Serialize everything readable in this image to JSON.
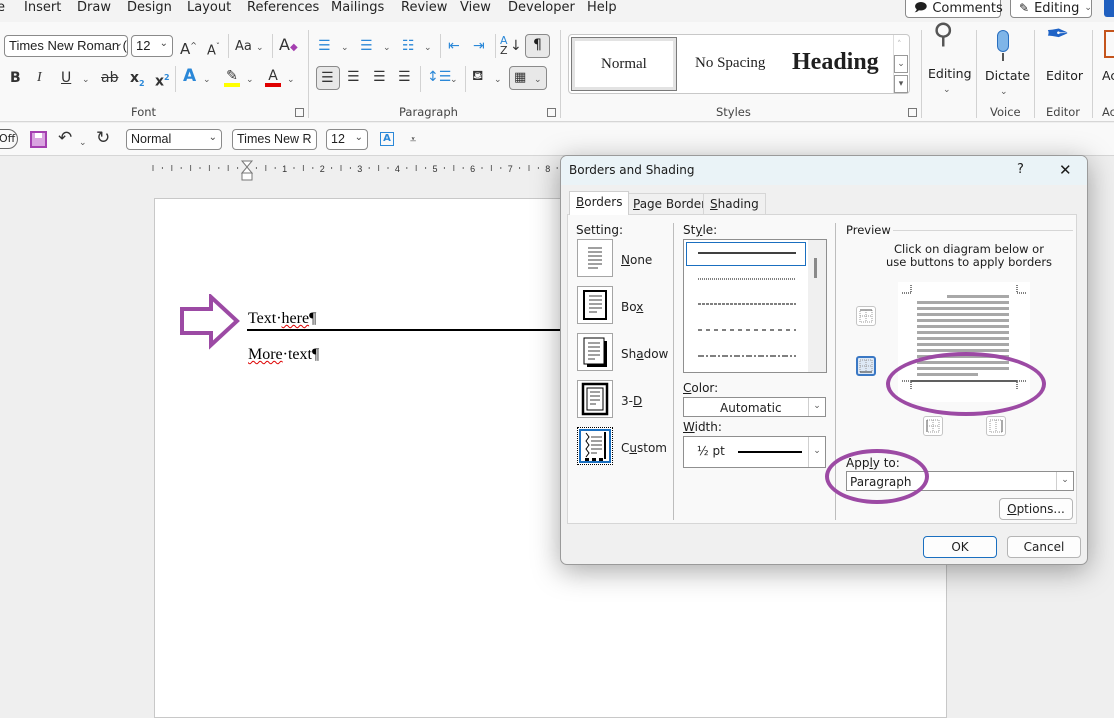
{
  "menubar": {
    "tabs": [
      "e",
      "Insert",
      "Draw",
      "Design",
      "Layout",
      "References",
      "Mailings",
      "Review",
      "View",
      "Developer",
      "Help"
    ],
    "comments_label": "Comments",
    "editing_mode_label": "Editing"
  },
  "ribbon": {
    "font": {
      "font_name": "Times New Roman (",
      "font_size": "12",
      "change_case_label": "Aa",
      "group_label": "Font",
      "highlight_color": "#ffff00",
      "font_color": "#e00000"
    },
    "paragraph": {
      "group_label": "Paragraph"
    },
    "styles": {
      "items": [
        "Normal",
        "No Spacing",
        "Heading"
      ],
      "group_label": "Styles"
    },
    "editing": {
      "label": "Editing"
    },
    "voice": {
      "dictate_label": "Dictate",
      "group_label": "Voice"
    },
    "editor": {
      "label": "Editor",
      "group_label": "Editor"
    },
    "addins": {
      "label": "Ac",
      "group_label": "Ac"
    }
  },
  "qat": {
    "autosave_label": "Off",
    "style_value": "Normal",
    "font_value": "Times New R",
    "size_value": "12"
  },
  "ruler": {
    "numbers": [
      "1",
      "2",
      "3",
      "4",
      "5",
      "6",
      "7",
      "8"
    ]
  },
  "document": {
    "line1": {
      "word1": "Text",
      "dot": "·",
      "word2": "here",
      "pilcrow": "¶"
    },
    "line2": {
      "word1": "More",
      "dot": "·",
      "word2": "text",
      "pilcrow": "¶"
    }
  },
  "dialog": {
    "title": "Borders and Shading",
    "help": "?",
    "close": "✕",
    "tabs": [
      {
        "u": "B",
        "rest": "orders",
        "active": true
      },
      {
        "u": "P",
        "rest": "age Border",
        "active": false
      },
      {
        "u": "S",
        "rest": "hading",
        "active": false
      }
    ],
    "setting_label": "Setting:",
    "settings": [
      {
        "pre": "",
        "u": "N",
        "post": "one"
      },
      {
        "pre": "Bo",
        "u": "x",
        "post": ""
      },
      {
        "pre": "Sh",
        "u": "a",
        "post": "dow"
      },
      {
        "pre": "3-",
        "u": "D",
        "post": ""
      },
      {
        "pre": "C",
        "u": "u",
        "post": "stom"
      }
    ],
    "selected_setting": "Custom",
    "style_label_pre": "St",
    "style_label_u": "y",
    "style_label_post": "le:",
    "style_options": [
      "solid",
      "dotted",
      "dashed-small",
      "dashed",
      "dash-dot"
    ],
    "selected_style": "solid",
    "color_label_u": "C",
    "color_label_post": "olor:",
    "color_value": "Automatic",
    "width_label_u": "W",
    "width_label_post": "idth:",
    "width_value": "½ pt",
    "preview_label": "Preview",
    "preview_hint_line1": "Click on diagram below or",
    "preview_hint_line2": "use buttons to apply borders",
    "apply_to_label_pre": "App",
    "apply_to_label_u": "l",
    "apply_to_label_post": "y to:",
    "apply_to_value": "Paragraph",
    "options_u": "O",
    "options_post": "ptions...",
    "ok_label": "OK",
    "cancel_label": "Cancel"
  },
  "annotations": {
    "color": "#9c4aa4"
  }
}
